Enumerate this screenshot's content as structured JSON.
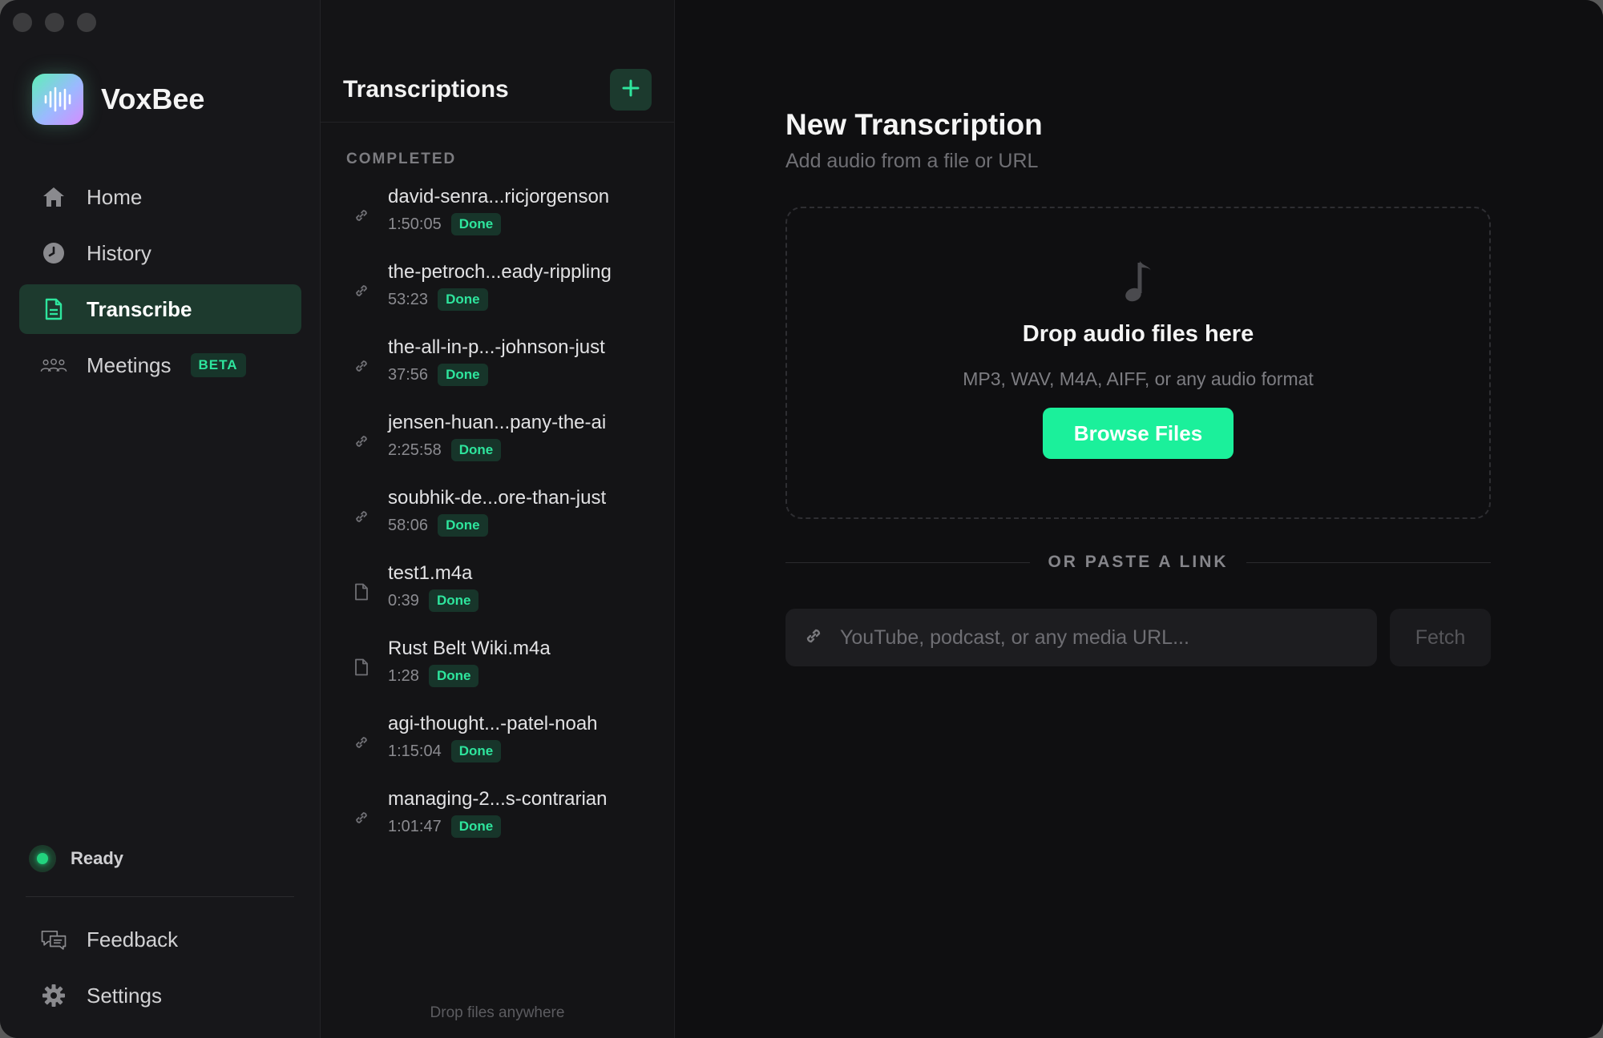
{
  "app": {
    "name": "VoxBee",
    "status": "Ready"
  },
  "sidebar": {
    "items": [
      {
        "label": "Home",
        "icon": "home-icon"
      },
      {
        "label": "History",
        "icon": "clock-icon"
      },
      {
        "label": "Transcribe",
        "icon": "document-icon",
        "active": true
      },
      {
        "label": "Meetings",
        "icon": "people-icon",
        "badge": "BETA"
      }
    ],
    "bottom_items": [
      {
        "label": "Feedback",
        "icon": "chat-icon"
      },
      {
        "label": "Settings",
        "icon": "gear-icon"
      }
    ]
  },
  "list": {
    "title": "Transcriptions",
    "section_label": "COMPLETED",
    "footer": "Drop files anywhere",
    "items": [
      {
        "name": "david-senra...ricjorgenson",
        "duration": "1:50:05",
        "status": "Done",
        "type": "link"
      },
      {
        "name": "the-petroch...eady-rippling",
        "duration": "53:23",
        "status": "Done",
        "type": "link"
      },
      {
        "name": "the-all-in-p...-johnson-just",
        "duration": "37:56",
        "status": "Done",
        "type": "link"
      },
      {
        "name": "jensen-huan...pany-the-ai",
        "duration": "2:25:58",
        "status": "Done",
        "type": "link"
      },
      {
        "name": "soubhik-de...ore-than-just",
        "duration": "58:06",
        "status": "Done",
        "type": "link"
      },
      {
        "name": "test1.m4a",
        "duration": "0:39",
        "status": "Done",
        "type": "file"
      },
      {
        "name": "Rust Belt Wiki.m4a",
        "duration": "1:28",
        "status": "Done",
        "type": "file"
      },
      {
        "name": "agi-thought...-patel-noah",
        "duration": "1:15:04",
        "status": "Done",
        "type": "link"
      },
      {
        "name": "managing-2...s-contrarian",
        "duration": "1:01:47",
        "status": "Done",
        "type": "link"
      }
    ]
  },
  "main": {
    "title": "New Transcription",
    "subtitle": "Add audio from a file or URL",
    "dropzone": {
      "title": "Drop audio files here",
      "subtitle": "MP3, WAV, M4A, AIFF, or any audio format",
      "button": "Browse Files"
    },
    "divider": "OR PASTE A LINK",
    "url": {
      "placeholder": "YouTube, podcast, or any media URL...",
      "value": "",
      "button": "Fetch"
    }
  },
  "colors": {
    "accent": "#1bf09b",
    "accent_text": "#2ee59d",
    "active_bg": "#1d3a2e",
    "background": "#0f0f11",
    "sidebar_bg": "#17171a"
  }
}
